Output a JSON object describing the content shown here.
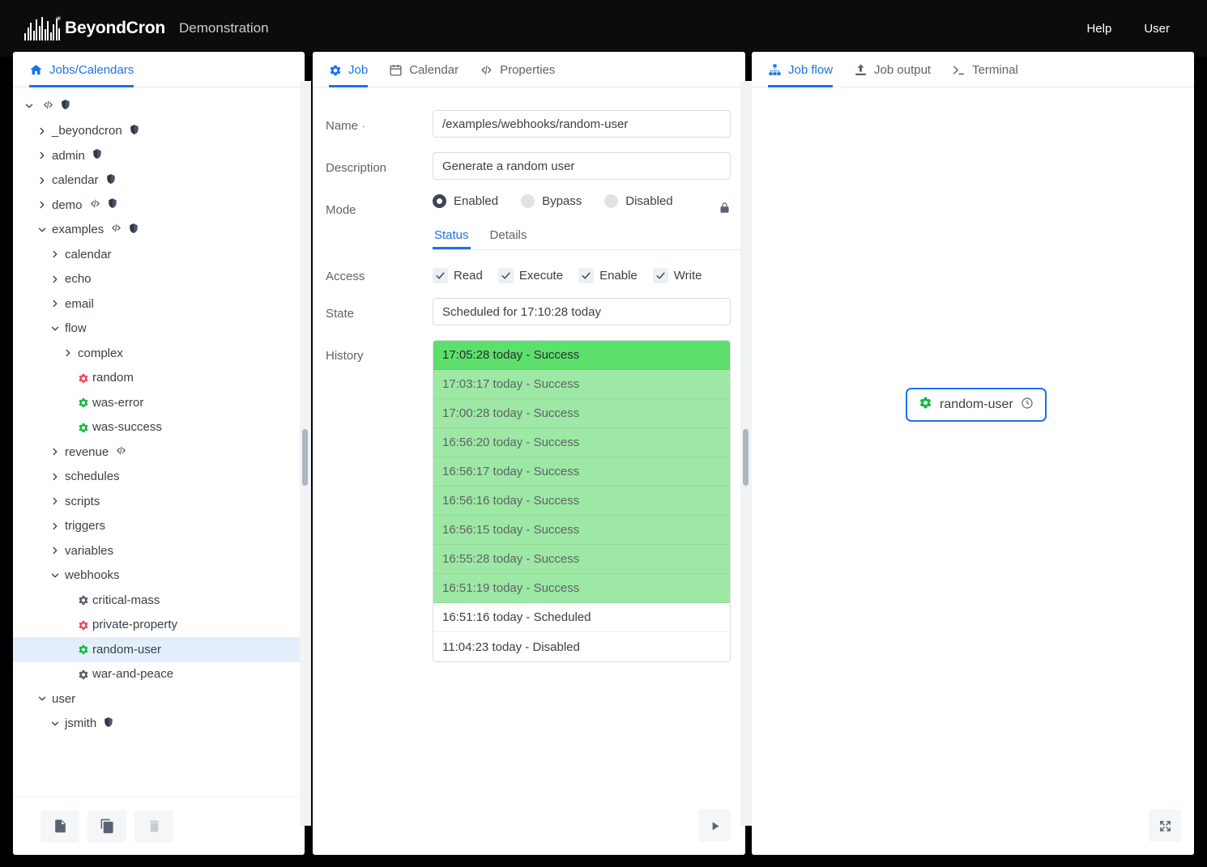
{
  "header": {
    "brand": "BeyondCron",
    "subtitle": "Demonstration",
    "help_label": "Help",
    "user_label": "User"
  },
  "left_panel": {
    "tab_label": "Jobs/Calendars",
    "tree": [
      {
        "label": "",
        "depth": 0,
        "chevron": "down",
        "icons": [
          "code",
          "shield"
        ],
        "type": "folder"
      },
      {
        "label": "_beyondcron",
        "depth": 1,
        "chevron": "right",
        "icons": [
          "shield"
        ],
        "type": "folder"
      },
      {
        "label": "admin",
        "depth": 1,
        "chevron": "right",
        "icons": [
          "shield"
        ],
        "type": "folder"
      },
      {
        "label": "calendar",
        "depth": 1,
        "chevron": "right",
        "icons": [
          "shield"
        ],
        "type": "folder"
      },
      {
        "label": "demo",
        "depth": 1,
        "chevron": "right",
        "icons": [
          "code",
          "shield"
        ],
        "type": "folder"
      },
      {
        "label": "examples",
        "depth": 1,
        "chevron": "down",
        "icons": [
          "code",
          "shield"
        ],
        "type": "folder"
      },
      {
        "label": "calendar",
        "depth": 2,
        "chevron": "right",
        "icons": [],
        "type": "folder"
      },
      {
        "label": "echo",
        "depth": 2,
        "chevron": "right",
        "icons": [],
        "type": "folder"
      },
      {
        "label": "email",
        "depth": 2,
        "chevron": "right",
        "icons": [],
        "type": "folder"
      },
      {
        "label": "flow",
        "depth": 2,
        "chevron": "down",
        "icons": [],
        "type": "folder"
      },
      {
        "label": "complex",
        "depth": 3,
        "chevron": "right",
        "icons": [],
        "type": "folder"
      },
      {
        "label": "random",
        "depth": 3,
        "chevron": "none",
        "icons": [],
        "type": "job",
        "gear": "red"
      },
      {
        "label": "was-error",
        "depth": 3,
        "chevron": "none",
        "icons": [],
        "type": "job",
        "gear": "green"
      },
      {
        "label": "was-success",
        "depth": 3,
        "chevron": "none",
        "icons": [],
        "type": "job",
        "gear": "green"
      },
      {
        "label": "revenue",
        "depth": 2,
        "chevron": "right",
        "icons": [
          "code"
        ],
        "type": "folder"
      },
      {
        "label": "schedules",
        "depth": 2,
        "chevron": "right",
        "icons": [],
        "type": "folder"
      },
      {
        "label": "scripts",
        "depth": 2,
        "chevron": "right",
        "icons": [],
        "type": "folder"
      },
      {
        "label": "triggers",
        "depth": 2,
        "chevron": "right",
        "icons": [],
        "type": "folder"
      },
      {
        "label": "variables",
        "depth": 2,
        "chevron": "right",
        "icons": [],
        "type": "folder"
      },
      {
        "label": "webhooks",
        "depth": 2,
        "chevron": "down",
        "icons": [],
        "type": "folder"
      },
      {
        "label": "critical-mass",
        "depth": 3,
        "chevron": "none",
        "icons": [],
        "type": "job",
        "gear": "gray"
      },
      {
        "label": "private-property",
        "depth": 3,
        "chevron": "none",
        "icons": [],
        "type": "job",
        "gear": "red"
      },
      {
        "label": "random-user",
        "depth": 3,
        "chevron": "none",
        "icons": [],
        "type": "job",
        "gear": "green",
        "selected": true
      },
      {
        "label": "war-and-peace",
        "depth": 3,
        "chevron": "none",
        "icons": [],
        "type": "job",
        "gear": "gray"
      },
      {
        "label": "user",
        "depth": 1,
        "chevron": "down",
        "icons": [],
        "type": "folder"
      },
      {
        "label": "jsmith",
        "depth": 2,
        "chevron": "down",
        "icons": [
          "shield"
        ],
        "type": "folder"
      }
    ],
    "toolbar": [
      {
        "name": "new-file-button",
        "icon": "file-icon",
        "disabled": false
      },
      {
        "name": "copy-button",
        "icon": "copy-icon",
        "disabled": false
      },
      {
        "name": "delete-button",
        "icon": "trash-icon",
        "disabled": true
      }
    ]
  },
  "center_panel": {
    "tabs": [
      {
        "label": "Job",
        "icon": "gear-icon",
        "active": true
      },
      {
        "label": "Calendar",
        "icon": "calendar-icon",
        "active": false
      },
      {
        "label": "Properties",
        "icon": "code-icon",
        "active": false
      }
    ],
    "fields": {
      "name_label": "Name",
      "name_required_marker": "·",
      "name_value": "/examples/webhooks/random-user",
      "description_label": "Description",
      "description_value": "Generate a random user",
      "mode_label": "Mode",
      "state_label": "State",
      "state_value": "Scheduled for 17:10:28 today",
      "access_label": "Access",
      "history_label": "History"
    },
    "mode_options": [
      {
        "label": "Enabled",
        "selected": true
      },
      {
        "label": "Bypass",
        "selected": false
      },
      {
        "label": "Disabled",
        "selected": false
      }
    ],
    "subtabs": [
      {
        "label": "Status",
        "active": true
      },
      {
        "label": "Details",
        "active": false
      }
    ],
    "access_options": [
      {
        "label": "Read",
        "checked": true
      },
      {
        "label": "Execute",
        "checked": true
      },
      {
        "label": "Enable",
        "checked": true
      },
      {
        "label": "Write",
        "checked": true
      }
    ],
    "history": [
      {
        "text": "17:05:28 today - Success",
        "style": "current"
      },
      {
        "text": "17:03:17 today - Success",
        "style": "success"
      },
      {
        "text": "17:00:28 today - Success",
        "style": "success"
      },
      {
        "text": "16:56:20 today - Success",
        "style": "success"
      },
      {
        "text": "16:56:17 today - Success",
        "style": "success"
      },
      {
        "text": "16:56:16 today - Success",
        "style": "success"
      },
      {
        "text": "16:56:15 today - Success",
        "style": "success"
      },
      {
        "text": "16:55:28 today - Success",
        "style": "success"
      },
      {
        "text": "16:51:19 today - Success",
        "style": "success"
      },
      {
        "text": "16:51:16 today - Scheduled",
        "style": "plain"
      },
      {
        "text": "11:04:23 today - Disabled",
        "style": "plain"
      }
    ],
    "run_button_icon": "play-icon",
    "lock_icon": "lock-icon"
  },
  "right_panel": {
    "tabs": [
      {
        "label": "Job flow",
        "icon": "sitemap-icon",
        "active": true
      },
      {
        "label": "Job output",
        "icon": "upload-icon",
        "active": false
      },
      {
        "label": "Terminal",
        "icon": "terminal-icon",
        "active": false
      }
    ],
    "node": {
      "label": "random-user",
      "gear_icon": "gear-icon",
      "clock_icon": "clock-icon"
    },
    "expand_button_icon": "expand-icon"
  },
  "colors": {
    "accent": "#1a73e8",
    "gear_green": "#15b83c",
    "gear_red": "#f3475a",
    "gear_gray": "#58606e",
    "history_current": "#5ce06b",
    "history_success": "#9de8a4",
    "selected_row": "#e3eefc"
  }
}
